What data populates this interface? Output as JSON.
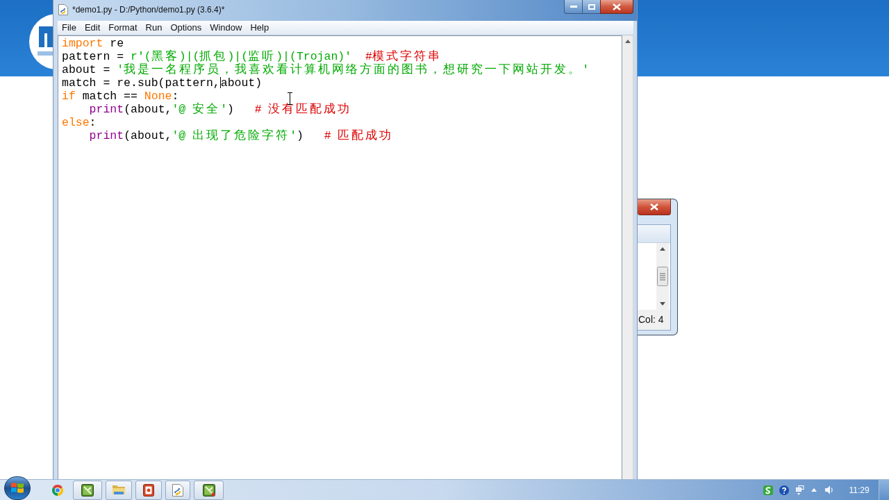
{
  "window": {
    "title": "*demo1.py - D:/Python/demo1.py (3.6.4)*"
  },
  "menu": [
    "File",
    "Edit",
    "Format",
    "Run",
    "Options",
    "Window",
    "Help"
  ],
  "editor": {
    "lines": [
      {
        "tokens": [
          {
            "kind": "keyword",
            "text": "import"
          },
          {
            "kind": "plain",
            "text": " re"
          }
        ]
      },
      {
        "tokens": [
          {
            "kind": "plain",
            "text": "pattern = "
          },
          {
            "kind": "string",
            "text": "r'(黑客)|(抓包)|(监听)|(Trojan)'"
          },
          {
            "kind": "comment",
            "text": "  #模式字符串"
          }
        ]
      },
      {
        "tokens": [
          {
            "kind": "plain",
            "text": "about = "
          },
          {
            "kind": "string",
            "text": "'我是一名程序员，我喜欢看计算机网络方面的图书，想研究一下网站开发。'"
          }
        ]
      },
      {
        "tokens": [
          {
            "kind": "plain",
            "text": "match = re.sub(pattern,"
          },
          {
            "kind": "caret"
          },
          {
            "kind": "plain",
            "text": "about)"
          }
        ]
      },
      {
        "tokens": [
          {
            "kind": "keyword",
            "text": "if"
          },
          {
            "kind": "plain",
            "text": " match == "
          },
          {
            "kind": "keyword",
            "text": "None"
          },
          {
            "kind": "plain",
            "text": ":"
          }
        ]
      },
      {
        "tokens": [
          {
            "kind": "builtin",
            "text": "    print"
          },
          {
            "kind": "plain",
            "text": "(about,"
          },
          {
            "kind": "string",
            "text": "'@ 安全'"
          },
          {
            "kind": "plain",
            "text": ")"
          },
          {
            "kind": "comment",
            "text": "   # 没有匹配成功"
          }
        ]
      },
      {
        "tokens": [
          {
            "kind": "keyword",
            "text": "else"
          },
          {
            "kind": "plain",
            "text": ":"
          }
        ]
      },
      {
        "tokens": [
          {
            "kind": "builtin",
            "text": "    print"
          },
          {
            "kind": "plain",
            "text": "(about,"
          },
          {
            "kind": "string",
            "text": "'@ 出现了危险字符'"
          },
          {
            "kind": "plain",
            "text": ")"
          },
          {
            "kind": "comment",
            "text": "   # 匹配成功"
          }
        ]
      }
    ]
  },
  "dialog": {
    "status": "Col: 4"
  },
  "taskbar": {
    "clock": "11:29"
  }
}
